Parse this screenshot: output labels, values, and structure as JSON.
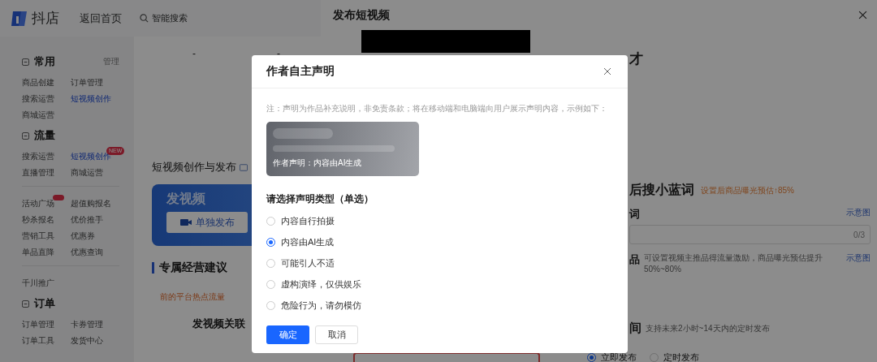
{
  "topbar": {
    "logo": "抖店",
    "home_link": "返回首页",
    "search_label": "智能搜索"
  },
  "sidebar": {
    "sections": [
      {
        "title": "常用",
        "action": "管理",
        "groups": [
          {
            "items": [
              {
                "label": "商品创建",
                "selected": false
              },
              {
                "label": "订单管理",
                "selected": false
              },
              {
                "label": "搜索运营",
                "selected": false
              },
              {
                "label": "短视频创作",
                "selected": true
              },
              {
                "label": "商城运营",
                "selected": false
              }
            ]
          }
        ]
      },
      {
        "title": "流量",
        "groups": [
          {
            "items": [
              {
                "label": "搜索运营",
                "selected": false
              },
              {
                "label": "短视频创作",
                "selected": true,
                "badge": {
                  "kind": "text",
                  "text": "NEW"
                }
              },
              {
                "label": "直播管理",
                "selected": false
              },
              {
                "label": "商城运营",
                "selected": false
              }
            ]
          },
          {
            "items": [
              {
                "label": "活动广场",
                "selected": false,
                "badge": {
                  "kind": "dot"
                }
              },
              {
                "label": "超值购报名",
                "selected": false
              },
              {
                "label": "秒杀报名",
                "selected": false
              },
              {
                "label": "优价推手",
                "selected": false
              },
              {
                "label": "营销工具",
                "selected": false
              },
              {
                "label": "优惠券",
                "selected": false
              },
              {
                "label": "单品直降",
                "selected": false
              },
              {
                "label": "优惠查询",
                "selected": false
              }
            ]
          },
          {
            "items": [
              {
                "label": "千川推广",
                "selected": false
              }
            ]
          }
        ]
      },
      {
        "title": "订单",
        "groups": [
          {
            "items": [
              {
                "label": "订单管理",
                "selected": false
              },
              {
                "label": "卡券管理",
                "selected": false
              },
              {
                "label": "订单工具",
                "selected": false
              },
              {
                "label": "发货中心",
                "selected": false
              }
            ]
          }
        ]
      }
    ]
  },
  "content": {
    "stats": [
      "-",
      "-"
    ],
    "title": "短视频创作与发布",
    "publish_card": {
      "title": "发视频",
      "button": "单独发布"
    },
    "advice": {
      "title": "专属经营建议",
      "hint": "前的平台热点流量",
      "subtitle": "发视频关联"
    }
  },
  "drawer": {
    "title": "发布短视频",
    "section_1_title": "才",
    "section_2": {
      "title": "后搜小蓝词",
      "note": "设置后商品曝光预估↑85%"
    },
    "keyword": {
      "label": "词",
      "link": "示意图",
      "counter": "0/3"
    },
    "product": {
      "label": "品",
      "description": "可设置视频主推品得流量激励，商品曝光预估提升50%~80%",
      "link": "示意图"
    },
    "schedule": {
      "label": "间",
      "description": "支持未来2小时~14天内的定时发布",
      "options": [
        {
          "label": "立即发布",
          "selected": true
        },
        {
          "label": "定时发布",
          "selected": false
        }
      ]
    }
  },
  "dialog": {
    "title": "作者自主声明",
    "note": "注：声明为作品补充说明，非免责条款；将在移动端和电脑端向用户展示声明内容，示例如下：",
    "example_text": "作者声明：内容由AI生成",
    "question": "请选择声明类型（单选）",
    "options": [
      {
        "label": "内容自行拍摄",
        "selected": false
      },
      {
        "label": "内容由AI生成",
        "selected": true
      },
      {
        "label": "可能引人不适",
        "selected": false
      },
      {
        "label": "虚构演绎，仅供娱乐",
        "selected": false
      },
      {
        "label": "危险行为，请勿模仿",
        "selected": false
      }
    ],
    "buttons": [
      {
        "label": "确定",
        "kind": "primary"
      },
      {
        "label": "取消",
        "kind": "default"
      }
    ]
  }
}
